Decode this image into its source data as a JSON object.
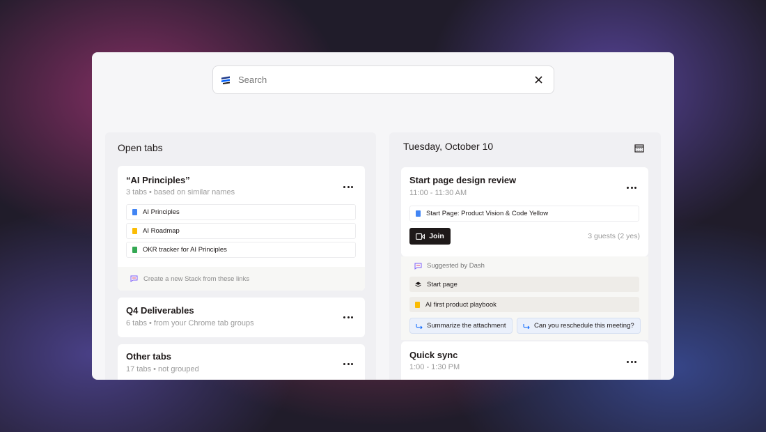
{
  "search": {
    "placeholder": "Search"
  },
  "left_panel": {
    "title": "Open tabs",
    "groups": [
      {
        "title": "“AI Principles”",
        "subtitle": "3 tabs • based on similar names",
        "links": [
          {
            "label": "AI Principles",
            "icon": "google-doc-icon",
            "color": "#4285f4"
          },
          {
            "label": "AI Roadmap",
            "icon": "google-slides-icon",
            "color": "#fbbc04"
          },
          {
            "label": "OKR tracker for AI Principles",
            "icon": "google-sheets-icon",
            "color": "#34a853"
          }
        ],
        "create_label": "Create a new Stack from these links"
      },
      {
        "title": "Q4 Deliverables",
        "subtitle": "6 tabs • from your Chrome tab groups"
      },
      {
        "title": "Other tabs",
        "subtitle": "17 tabs • not grouped"
      }
    ]
  },
  "right_panel": {
    "date": "Tuesday, October 10",
    "events": [
      {
        "title": "Start page design review",
        "time": "11:00 - 11:30 AM",
        "attachment": "Start Page: Product Vision & Code Yellow",
        "join_label": "Join",
        "guests": "3 guests (2 yes)",
        "suggested_label": "Suggested by Dash",
        "suggestions": [
          {
            "label": "Start page",
            "icon": "stack-icon"
          },
          {
            "label": "AI first product playbook",
            "icon": "google-slides-icon"
          }
        ],
        "actions": [
          "Summarize the attachment",
          "Can you reschedule this meeting?"
        ]
      },
      {
        "title": "Quick sync",
        "time": "1:00 - 1:30 PM"
      }
    ]
  },
  "colors": {
    "accent_dark": "#1e1919",
    "dropbox_blue": "#0061fe",
    "chip_bg": "#eaf0fb"
  }
}
